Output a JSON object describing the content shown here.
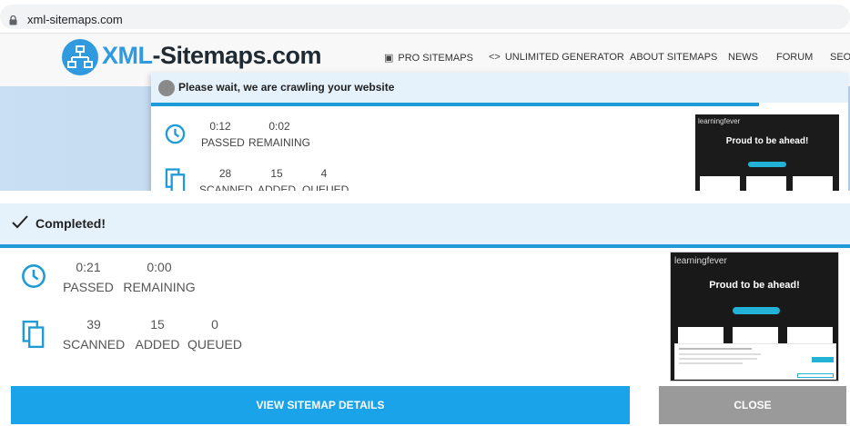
{
  "browser": {
    "url": "xml-sitemaps.com"
  },
  "site": {
    "logo_xml": "XML",
    "logo_rest": "-Sitemaps.com",
    "nav": [
      {
        "label": "PRO SITEMAPS",
        "icon": "pro-icon"
      },
      {
        "label": "UNLIMITED GENERATOR",
        "icon": "code-icon"
      },
      {
        "label": "ABOUT SITEMAPS"
      },
      {
        "label": "NEWS"
      },
      {
        "label": "FORUM"
      },
      {
        "label": "SEO"
      }
    ]
  },
  "crawling_dialog": {
    "title": "Please wait, we are crawling your website",
    "passed": "0:12",
    "remaining": "0:02",
    "scanned": "28",
    "added": "15",
    "queued": "4",
    "labels": {
      "passed": "PASSED",
      "remaining": "REMAINING",
      "scanned": "SCANNED",
      "added": "ADDED",
      "queued": "QUEUED"
    }
  },
  "completed_dialog": {
    "title": "Completed!",
    "passed": "0:21",
    "remaining": "0:00",
    "scanned": "39",
    "added": "15",
    "queued": "0",
    "labels": {
      "passed": "PASSED",
      "remaining": "REMAINING",
      "scanned": "SCANNED",
      "added": "ADDED",
      "queued": "QUEUED"
    },
    "preview": {
      "brand": "learningfever",
      "tagline": "Proud to be ahead!"
    },
    "buttons": {
      "details": "VIEW SITEMAP DETAILS",
      "close": "CLOSE"
    }
  },
  "colors": {
    "accent": "#1aa3e8",
    "progress": "#1e9bd7",
    "header_bg": "#e6f2fb",
    "close_bg": "#9a9a9a"
  }
}
